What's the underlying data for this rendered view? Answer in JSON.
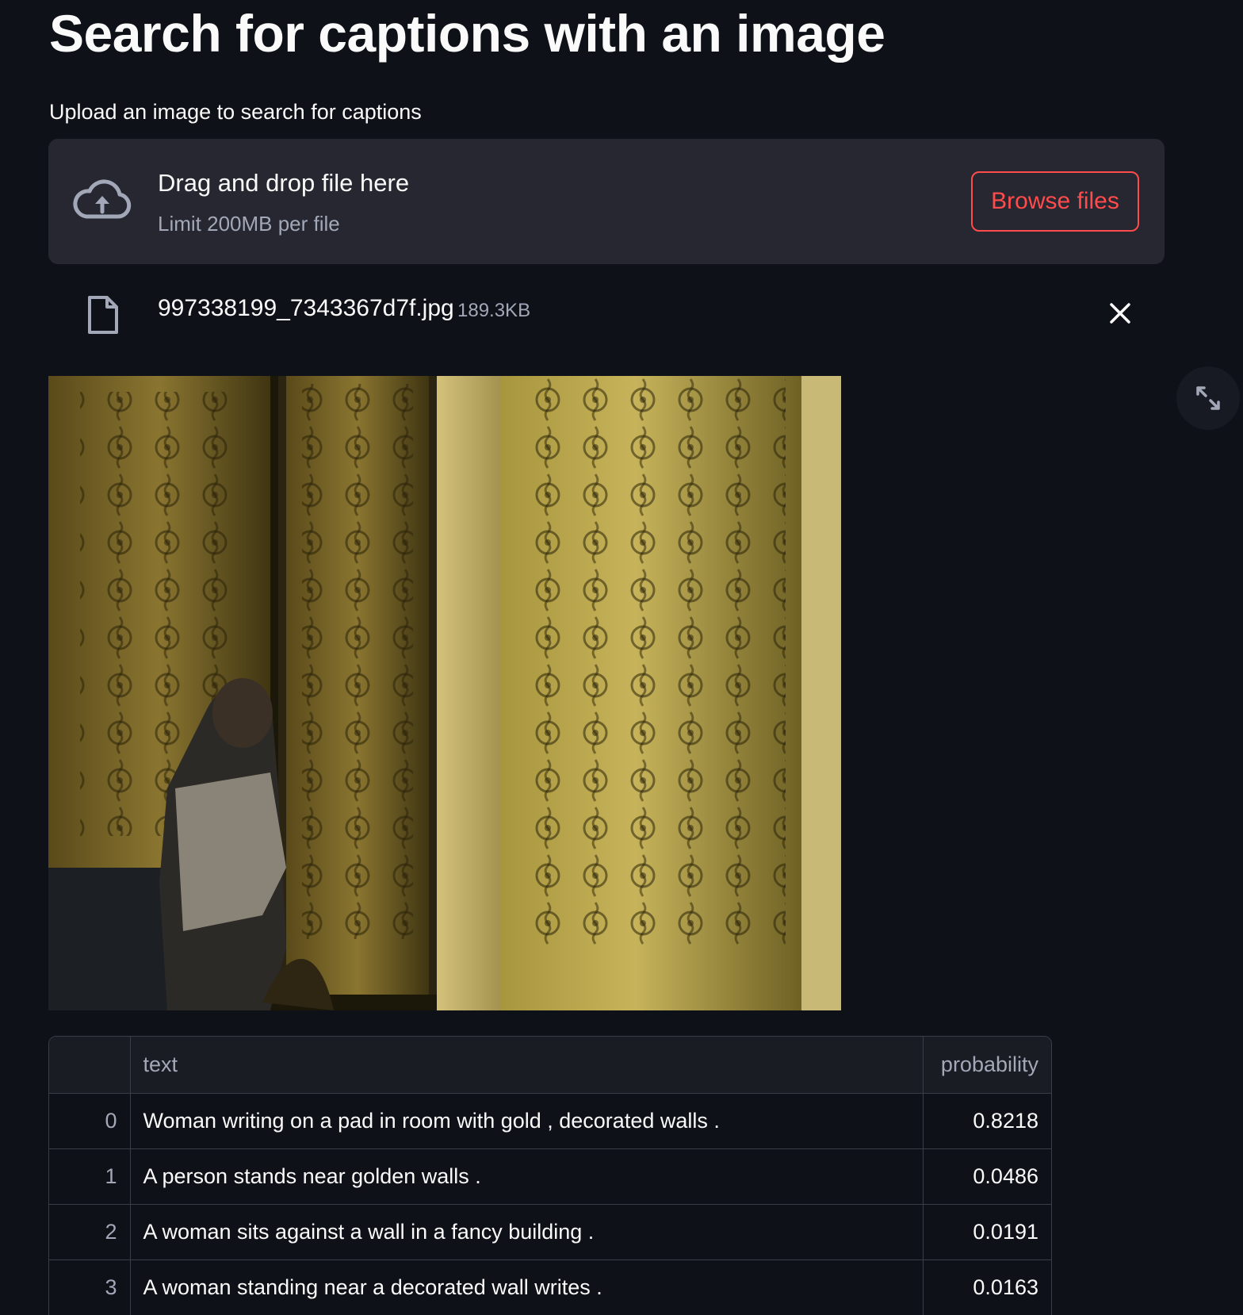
{
  "page": {
    "title": "Search for captions with an image",
    "upload_label": "Upload an image to search for captions"
  },
  "uploader": {
    "drop_text": "Drag and drop file here",
    "limit_text": "Limit 200MB per file",
    "browse_label": "Browse files",
    "icon": "cloud-upload-icon"
  },
  "file": {
    "name": "997338199_7343367d7f.jpg",
    "size": "189.3KB",
    "icon": "file-icon",
    "remove_icon": "close-icon"
  },
  "image": {
    "description_icon": "uploaded-photo",
    "fullscreen_icon": "expand-icon"
  },
  "results": {
    "columns": [
      "",
      "text",
      "probability"
    ],
    "rows": [
      {
        "index": "0",
        "text": "Woman writing on a pad in room with gold , decorated walls .",
        "probability": "0.8218"
      },
      {
        "index": "1",
        "text": "A person stands near golden walls .",
        "probability": "0.0486"
      },
      {
        "index": "2",
        "text": "A woman sits against a wall in a fancy building .",
        "probability": "0.0191"
      },
      {
        "index": "3",
        "text": "A woman standing near a decorated wall writes .",
        "probability": "0.0163"
      }
    ]
  },
  "colors": {
    "background": "#0e1117",
    "accent": "#ff4b4b",
    "dropzone": "#262730",
    "muted_text": "#a3a8b8"
  }
}
